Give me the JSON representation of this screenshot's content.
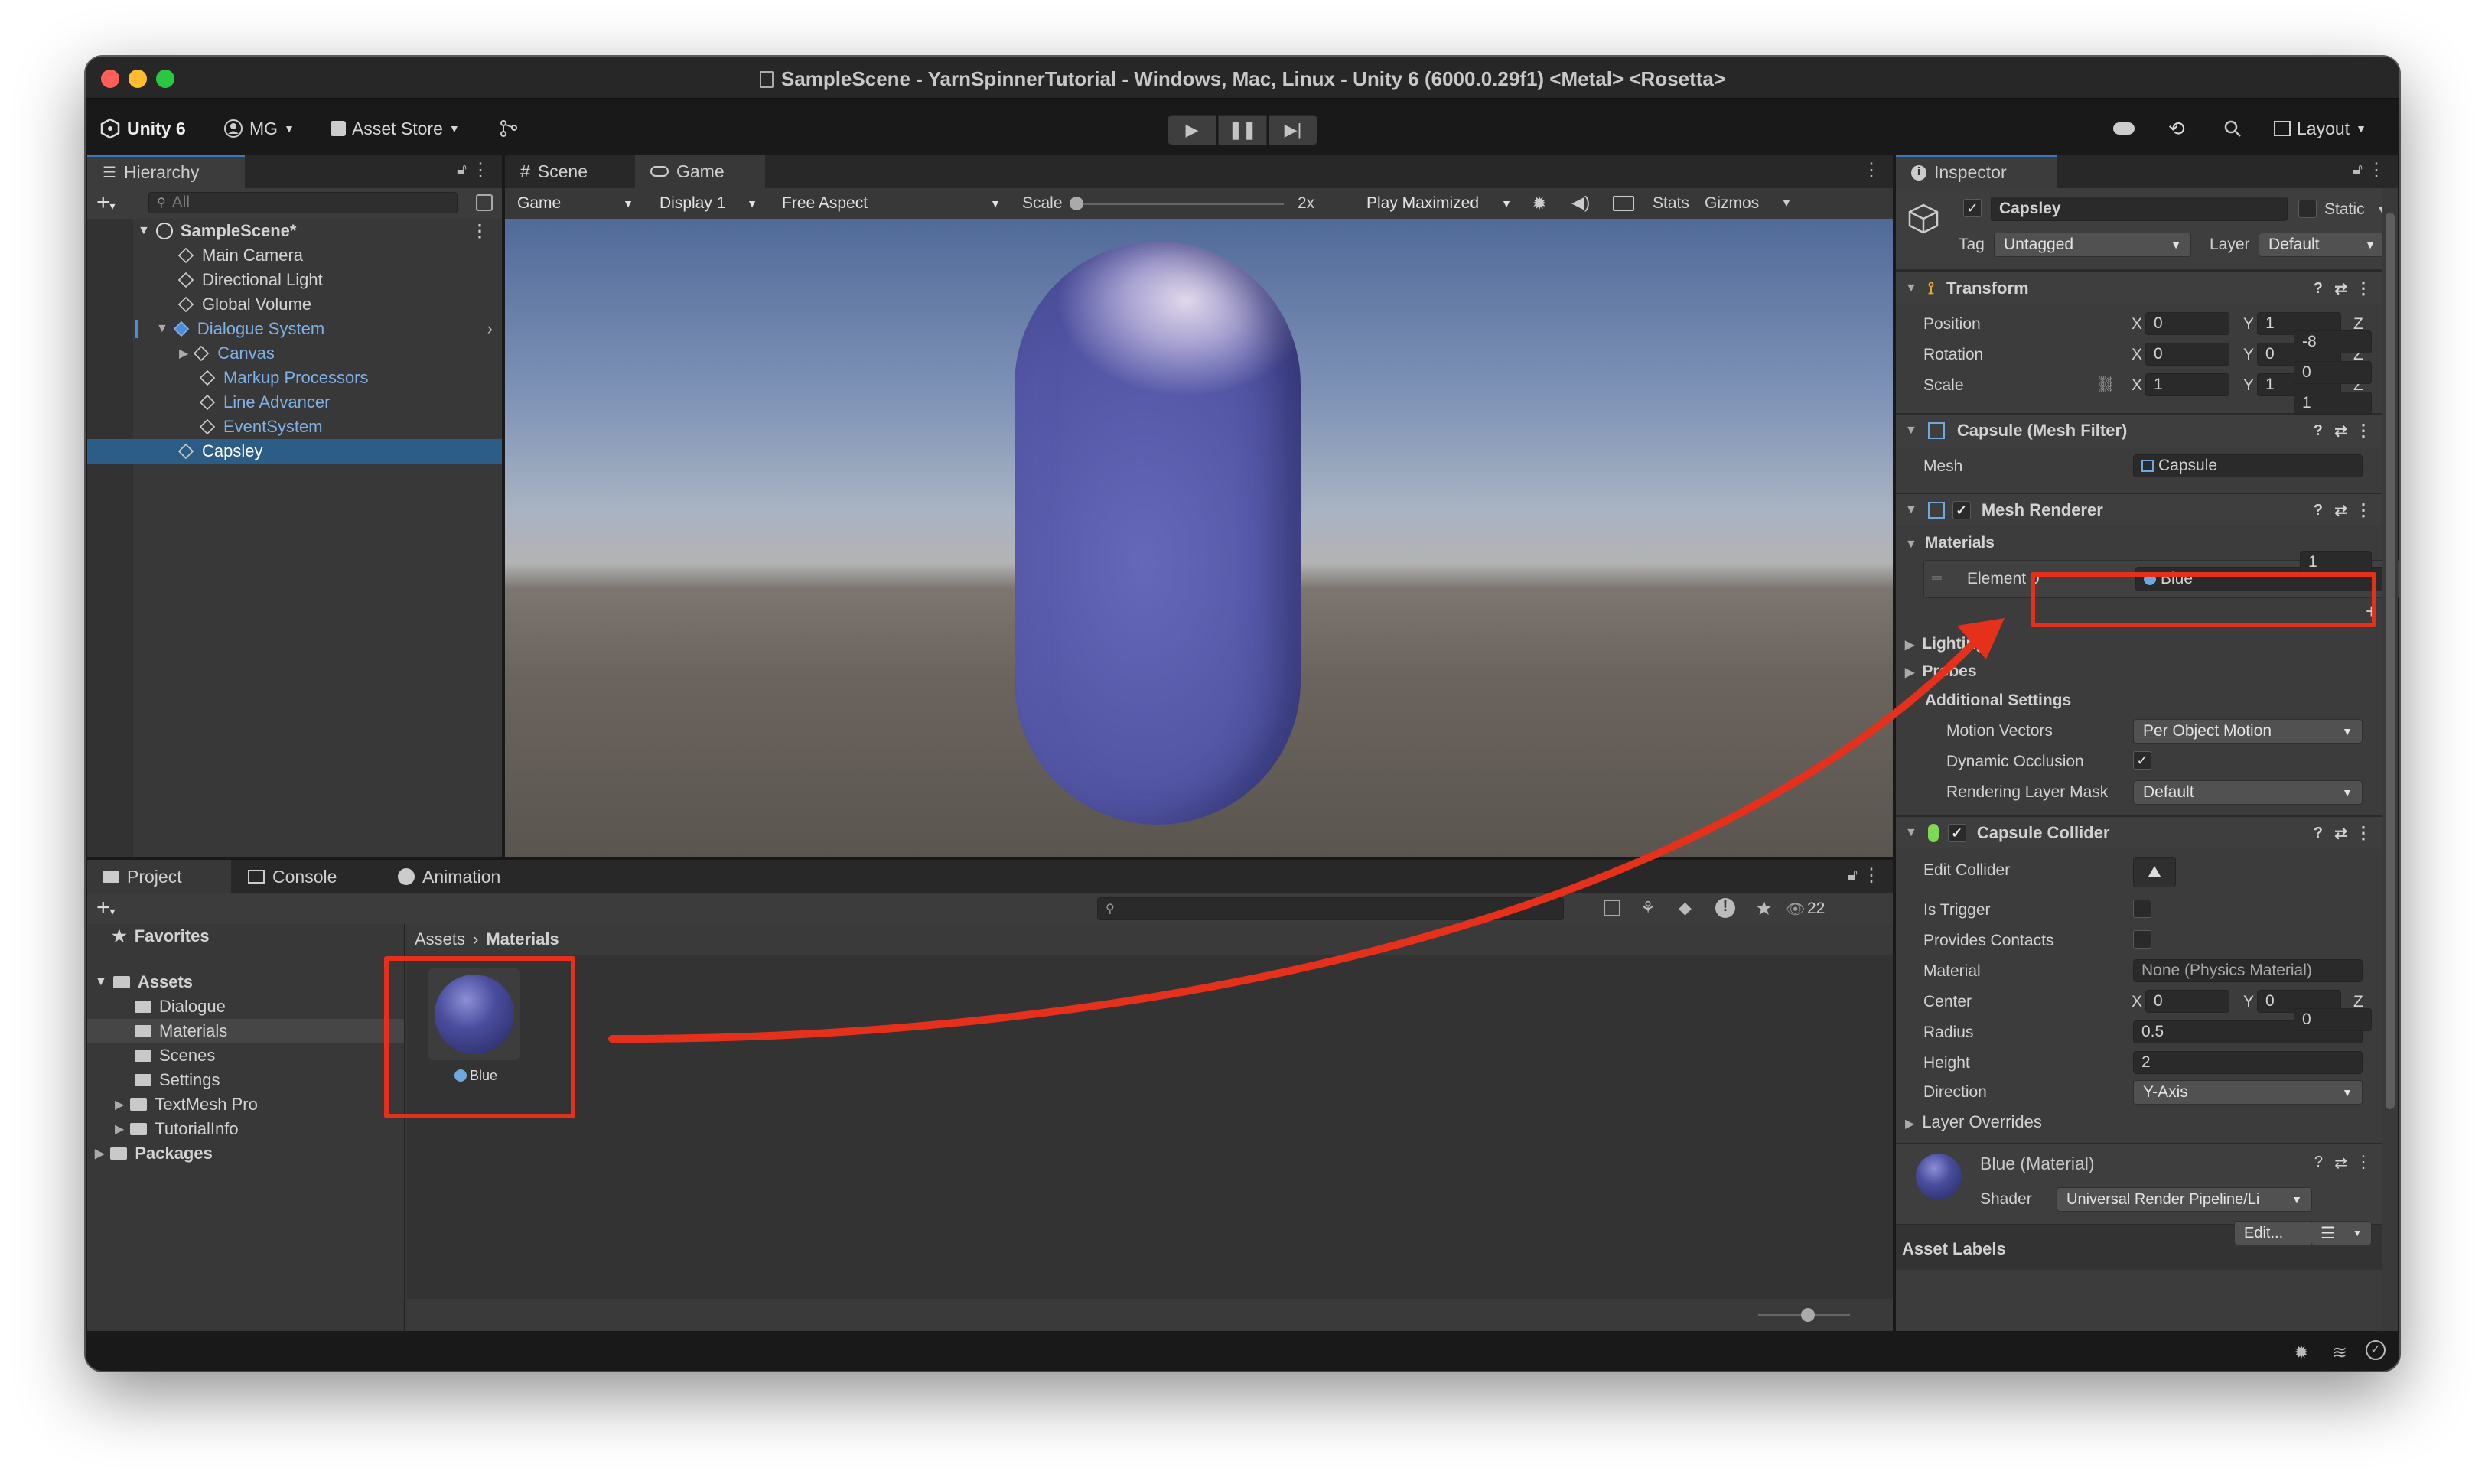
{
  "window": {
    "title": "SampleScene - YarnSpinnerTutorial - Windows, Mac, Linux - Unity 6 (6000.0.29f1) <Metal> <Rosetta>"
  },
  "toolbar": {
    "brand": "Unity 6",
    "account": "MG",
    "asset_store": "Asset Store",
    "layout": "Layout"
  },
  "hierarchy": {
    "tab": "Hierarchy",
    "search_placeholder": "All",
    "scene": "SampleScene*",
    "items": [
      {
        "label": "Main Camera"
      },
      {
        "label": "Directional Light"
      },
      {
        "label": "Global Volume"
      },
      {
        "label": "Dialogue System"
      },
      {
        "label": "Canvas"
      },
      {
        "label": "Markup Processors"
      },
      {
        "label": "Line Advancer"
      },
      {
        "label": "EventSystem"
      },
      {
        "label": "Capsley"
      }
    ]
  },
  "game_view": {
    "tabs": {
      "scene": "Scene",
      "game": "Game"
    },
    "mode": "Game",
    "display": "Display 1",
    "aspect": "Free Aspect",
    "scale_label": "Scale",
    "scale_value": "2x",
    "play_mode": "Play Maximized",
    "stats": "Stats",
    "gizmos": "Gizmos"
  },
  "project": {
    "tabs": {
      "project": "Project",
      "console": "Console",
      "animation": "Animation"
    },
    "count": "22",
    "favorites": "Favorites",
    "assets": "Assets",
    "folders": [
      "Dialogue",
      "Materials",
      "Scenes",
      "Settings",
      "TextMesh Pro",
      "TutorialInfo"
    ],
    "packages": "Packages",
    "breadcrumb": {
      "root": "Assets",
      "current": "Materials"
    },
    "asset_name": "Blue"
  },
  "inspector": {
    "tab": "Inspector",
    "object_name": "Capsley",
    "static_label": "Static",
    "tag_label": "Tag",
    "tag_value": "Untagged",
    "layer_label": "Layer",
    "layer_value": "Default",
    "transform": {
      "header": "Transform",
      "position_label": "Position",
      "position": {
        "x": "0",
        "y": "1",
        "z": "-8"
      },
      "rotation_label": "Rotation",
      "rotation": {
        "x": "0",
        "y": "0",
        "z": "0"
      },
      "scale_label": "Scale",
      "scale": {
        "x": "1",
        "y": "1",
        "z": "1"
      }
    },
    "mesh_filter": {
      "header": "Capsule (Mesh Filter)",
      "mesh_label": "Mesh",
      "mesh_value": "Capsule"
    },
    "mesh_renderer": {
      "header": "Mesh Renderer",
      "materials_label": "Materials",
      "materials_count": "1",
      "element_label": "Element 0",
      "element_value": "Blue",
      "lighting": "Lighting",
      "probes": "Probes",
      "additional": "Additional Settings",
      "motion_vectors_label": "Motion Vectors",
      "motion_vectors_value": "Per Object Motion",
      "dynamic_occlusion_label": "Dynamic Occlusion",
      "rendering_layer_label": "Rendering Layer Mask",
      "rendering_layer_value": "Default"
    },
    "capsule_collider": {
      "header": "Capsule Collider",
      "edit_label": "Edit Collider",
      "is_trigger_label": "Is Trigger",
      "provides_contacts_label": "Provides Contacts",
      "material_label": "Material",
      "material_value": "None (Physics Material)",
      "center_label": "Center",
      "center": {
        "x": "0",
        "y": "0",
        "z": "0"
      },
      "radius_label": "Radius",
      "radius_value": "0.5",
      "height_label": "Height",
      "height_value": "2",
      "direction_label": "Direction",
      "direction_value": "Y-Axis",
      "layer_overrides": "Layer Overrides"
    },
    "material_preview": {
      "name": "Blue (Material)",
      "shader_label": "Shader",
      "shader_value": "Universal Render Pipeline/Li",
      "edit_button": "Edit..."
    },
    "asset_labels": "Asset Labels"
  },
  "colors": {
    "accent": "#3a79bb",
    "annotation": "#e5301c",
    "capsule": "#5f62b4"
  }
}
